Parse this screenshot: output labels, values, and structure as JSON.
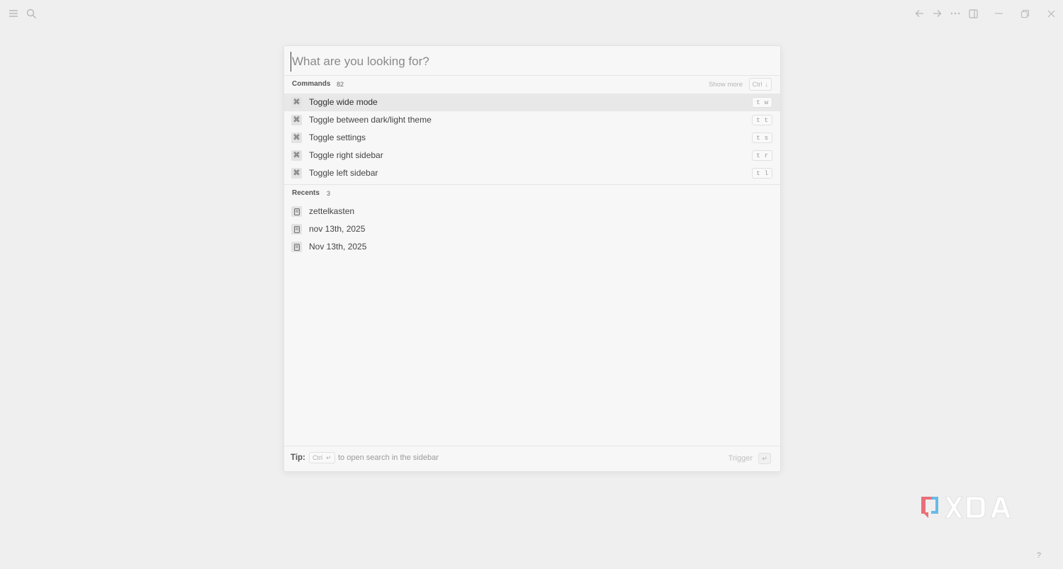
{
  "toolbar": {
    "left_icons": [
      "menu-icon",
      "search-icon"
    ],
    "right_icons": [
      "arrow-left-icon",
      "arrow-right-icon",
      "more-icon",
      "sidebar-icon",
      "minimize-icon",
      "restore-icon",
      "close-icon"
    ]
  },
  "search": {
    "placeholder": "What are you looking for?",
    "value": ""
  },
  "commands": {
    "title": "Commands",
    "count": "82",
    "show_more": "Show more",
    "show_more_key": "Ctrl",
    "show_more_arrow": "↓",
    "items": [
      {
        "label": "Toggle wide mode",
        "keys": [
          "t",
          "w"
        ],
        "icon": "command-icon",
        "active": true
      },
      {
        "label": "Toggle between dark/light theme",
        "keys": [
          "t",
          "t"
        ],
        "icon": "command-icon"
      },
      {
        "label": "Toggle settings",
        "keys": [
          "t",
          "s"
        ],
        "icon": "command-icon"
      },
      {
        "label": "Toggle right sidebar",
        "keys": [
          "t",
          "r"
        ],
        "icon": "command-icon"
      },
      {
        "label": "Toggle left sidebar",
        "keys": [
          "t",
          "l"
        ],
        "icon": "command-icon"
      }
    ]
  },
  "recents": {
    "title": "Recents",
    "count": "3",
    "items": [
      {
        "label": "zettelkasten",
        "icon": "page-icon"
      },
      {
        "label": "nov 13th, 2025",
        "icon": "page-icon"
      },
      {
        "label": "Nov 13th, 2025",
        "icon": "page-icon"
      }
    ]
  },
  "footer": {
    "tip_label": "Tip:",
    "tip_key": "Ctrl",
    "tip_enter": "↵",
    "tip_text": "to open search in the sidebar",
    "trigger_label": "Trigger",
    "trigger_key": "↵"
  },
  "watermark": {
    "text": "XDA"
  },
  "help": {
    "label": "?"
  },
  "colors": {
    "background": "#efefef",
    "dialog": "#f7f7f7",
    "active_row": "#e8e8e8",
    "watermark_red": "#e8616d",
    "watermark_blue": "#5ab4e6"
  }
}
